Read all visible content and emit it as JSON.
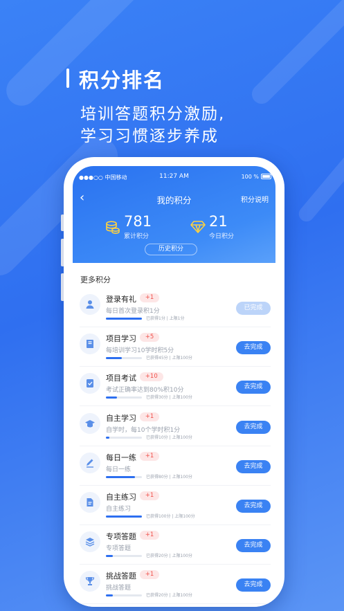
{
  "hero": {
    "title": "积分排名",
    "sub1": "培训答题积分激励,",
    "sub2": "学习习惯逐步养成"
  },
  "status": {
    "carrier": "●●●○○ 中国移动",
    "time": "11:27 AM",
    "battery": "100 %"
  },
  "nav": {
    "back": "‹",
    "title": "我的积分",
    "right": "积分说明"
  },
  "stats": {
    "total": {
      "value": "781",
      "label": "累计积分"
    },
    "today": {
      "value": "21",
      "label": "今日积分"
    }
  },
  "history_label": "历史积分",
  "more_label": "更多积分",
  "items": [
    {
      "title": "登录有礼",
      "badge": "+1",
      "desc": "每日首次登录积1分",
      "progress_text": "已获得1分 | 上限1分",
      "button": "已完成",
      "done": true,
      "progress": 1.0,
      "icon": "user-icon"
    },
    {
      "title": "项目学习",
      "badge": "+5",
      "desc": "每培训学习10学时积5分",
      "progress_text": "已获得45分 | 上限100分",
      "button": "去完成",
      "done": false,
      "progress": 0.45,
      "icon": "book-icon"
    },
    {
      "title": "项目考试",
      "badge": "+10",
      "desc": "考试正确率达到80%积10分",
      "progress_text": "已获得30分 | 上限100分",
      "button": "去完成",
      "done": false,
      "progress": 0.3,
      "icon": "exam-icon"
    },
    {
      "title": "自主学习",
      "badge": "+1",
      "desc": "自学时，每10个学时积1分",
      "progress_text": "已获得10分 | 上限100分",
      "button": "去完成",
      "done": false,
      "progress": 0.1,
      "icon": "graduation-cap-icon"
    },
    {
      "title": "每日一练",
      "badge": "+1",
      "desc": "每日一练",
      "progress_text": "已获得80分 | 上限100分",
      "button": "去完成",
      "done": false,
      "progress": 0.8,
      "icon": "pencil-icon"
    },
    {
      "title": "自主练习",
      "badge": "+1",
      "desc": "自主练习",
      "progress_text": "已获得100分 | 上限100分",
      "button": "去完成",
      "done": false,
      "progress": 1.0,
      "icon": "document-icon"
    },
    {
      "title": "专项答题",
      "badge": "+1",
      "desc": "专项答题",
      "progress_text": "已获得20分 | 上限100分",
      "button": "去完成",
      "done": false,
      "progress": 0.2,
      "icon": "layers-icon"
    },
    {
      "title": "挑战答题",
      "badge": "+1",
      "desc": "挑战答题",
      "progress_text": "已获得20分 | 上限100分",
      "button": "去完成",
      "done": false,
      "progress": 0.2,
      "icon": "trophy-icon"
    }
  ]
}
